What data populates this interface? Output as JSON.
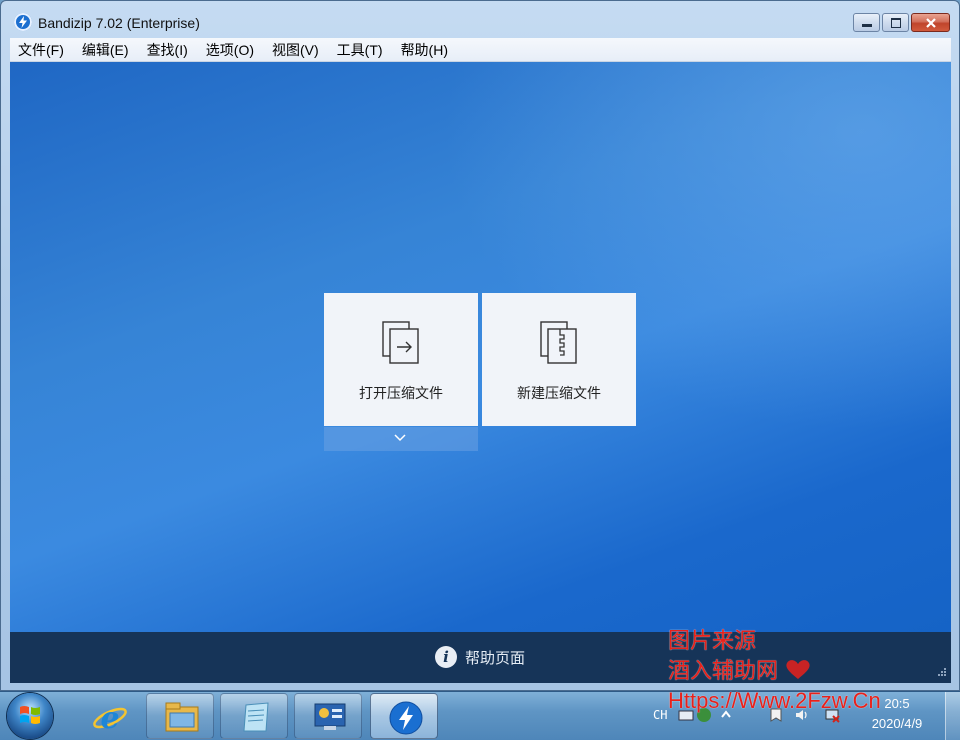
{
  "window": {
    "title": "Bandizip 7.02 (Enterprise)"
  },
  "menubar": {
    "items": [
      {
        "label": "文件(F)"
      },
      {
        "label": "编辑(E)"
      },
      {
        "label": "查找(I)"
      },
      {
        "label": "选项(O)"
      },
      {
        "label": "视图(V)"
      },
      {
        "label": "工具(T)"
      },
      {
        "label": "帮助(H)"
      }
    ]
  },
  "main": {
    "open_archive_label": "打开压缩文件",
    "new_archive_label": "新建压缩文件"
  },
  "helpbar": {
    "label": "帮助页面"
  },
  "taskbar": {
    "lang": "CH",
    "clock_time": "20:5",
    "clock_date": "2020/4/9"
  },
  "watermark": {
    "line1": "图片来源",
    "line2": "酒入辅助网",
    "line3": "Https://Www.2Fzw.Cn"
  },
  "colors": {
    "client_blue": "#2f7ad2",
    "help_bar": "#163458",
    "tile_bg": "#f1f4f9",
    "watermark_red": "#e8211b"
  }
}
